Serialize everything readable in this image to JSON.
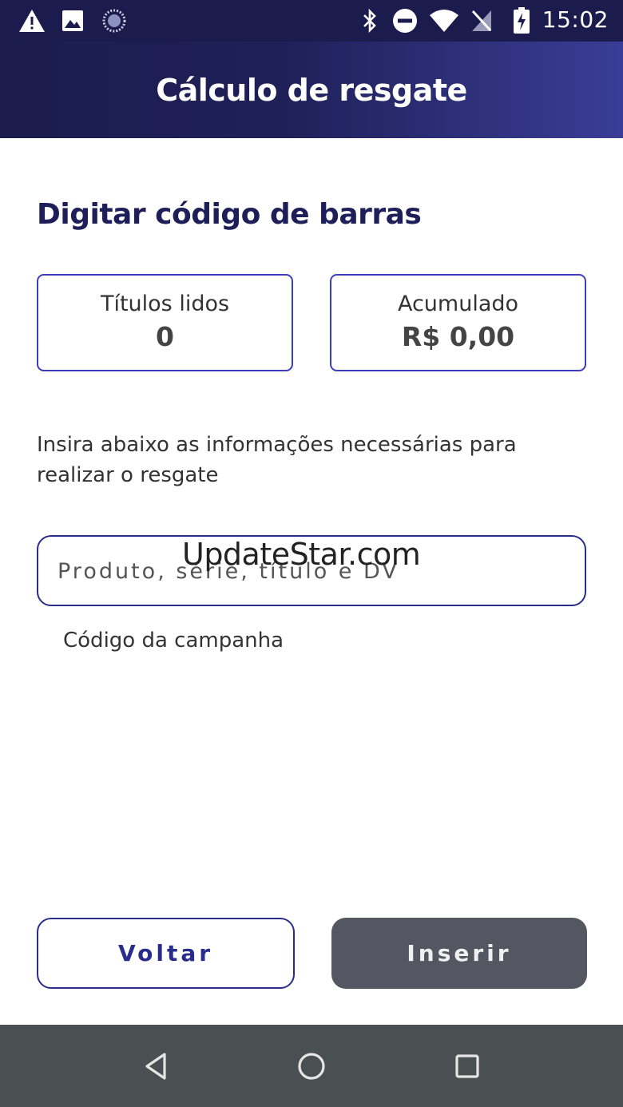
{
  "status_bar": {
    "time": "15:02",
    "icons": [
      "warning-icon",
      "image-icon",
      "sync-icon",
      "bluetooth-icon",
      "do-not-disturb-icon",
      "wifi-icon",
      "no-signal-icon",
      "battery-charging-icon"
    ]
  },
  "app_bar": {
    "title": "Cálculo de resgate"
  },
  "main": {
    "section_title": "Digitar código de barras",
    "cards": [
      {
        "label": "Títulos lidos",
        "value": "0"
      },
      {
        "label": "Acumulado",
        "value": "R$ 0,00"
      }
    ],
    "instructions": "Insira abaixo as informações necessárias para realizar o resgate",
    "input": {
      "placeholder": "Produto, série, título e DV",
      "value": ""
    },
    "watermark": "UpdateStar.com",
    "campaign_label": "Código da campanha"
  },
  "actions": {
    "back_label": "Voltar",
    "insert_label": "Inserir"
  },
  "nav_bar": {
    "buttons": [
      "back-icon",
      "home-icon",
      "recents-icon"
    ]
  },
  "colors": {
    "primary": "#1e1f58",
    "accent_border": "#3b3ec0",
    "disabled_button": "#545662",
    "nav_bar": "#4a4f52"
  }
}
